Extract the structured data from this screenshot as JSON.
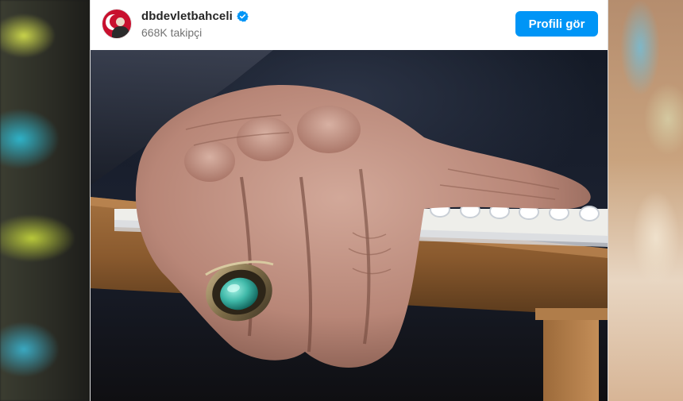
{
  "post": {
    "username": "dbdevletbahceli",
    "followers": "668K takipçi",
    "view_profile_label": "Profili gör",
    "verified": true
  },
  "icons": {
    "avatar": "profile-avatar",
    "verified": "verified-badge-icon"
  },
  "colors": {
    "primary_button": "#0095f6",
    "verified_badge": "#0095f6",
    "username_text": "#262626",
    "secondary_text": "#737373"
  }
}
